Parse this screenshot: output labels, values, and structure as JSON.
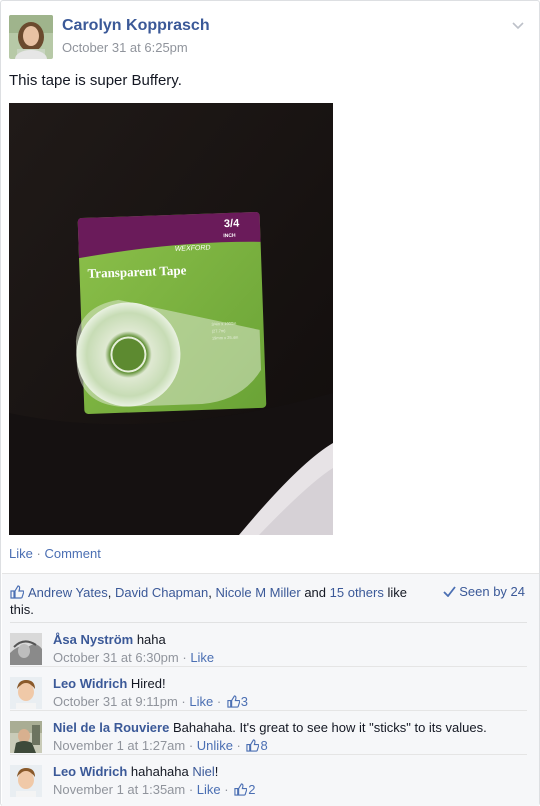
{
  "post": {
    "author": "Carolyn Kopprasch",
    "timestamp": "October 31 at 6:25pm",
    "text": "This tape is super Buffery.",
    "photo": {
      "brand": "WEXFORD",
      "product": "Transparent Tape",
      "size": "3/4",
      "size_unit": "INCH",
      "fine_print_1": "3/4in x 1000in",
      "fine_print_2": "(27.7m)",
      "fine_print_3": "19mm x 25.4m"
    }
  },
  "actions": {
    "like": "Like",
    "separator": "·",
    "comment": "Comment"
  },
  "likes": {
    "names": [
      "Andrew Yates",
      "David Chapman",
      "Nicole M Miller"
    ],
    "comma": ",",
    "and_text": "and",
    "others_text": "15 others",
    "suffix": "like this."
  },
  "seen_by": "Seen by 24",
  "comments": [
    {
      "name": "Åsa Nyström",
      "text": "haha",
      "time": "October 31 at 6:30pm",
      "action": "Like",
      "like_count": ""
    },
    {
      "name": "Leo Widrich",
      "text": "Hired!",
      "time": "October 31 at 9:11pm",
      "action": "Like",
      "like_count": "3"
    },
    {
      "name": "Niel de la Rouviere",
      "text": "Bahahaha. It's great to see how it \"sticks\" to its values.",
      "time": "November 1 at 1:27am",
      "action": "Unlike",
      "like_count": "8"
    },
    {
      "name": "Leo Widrich",
      "text": "hahahaha",
      "mention": "Niel",
      "text_after": "!",
      "time": "November 1 at 1:35am",
      "action": "Like",
      "like_count": "2"
    }
  ],
  "colors": {
    "link": "#3b5998",
    "meta": "#90949c",
    "feedback_bg": "#f6f7f9",
    "tape_green": "#7cb342",
    "tape_purple": "#6a1b5a"
  }
}
